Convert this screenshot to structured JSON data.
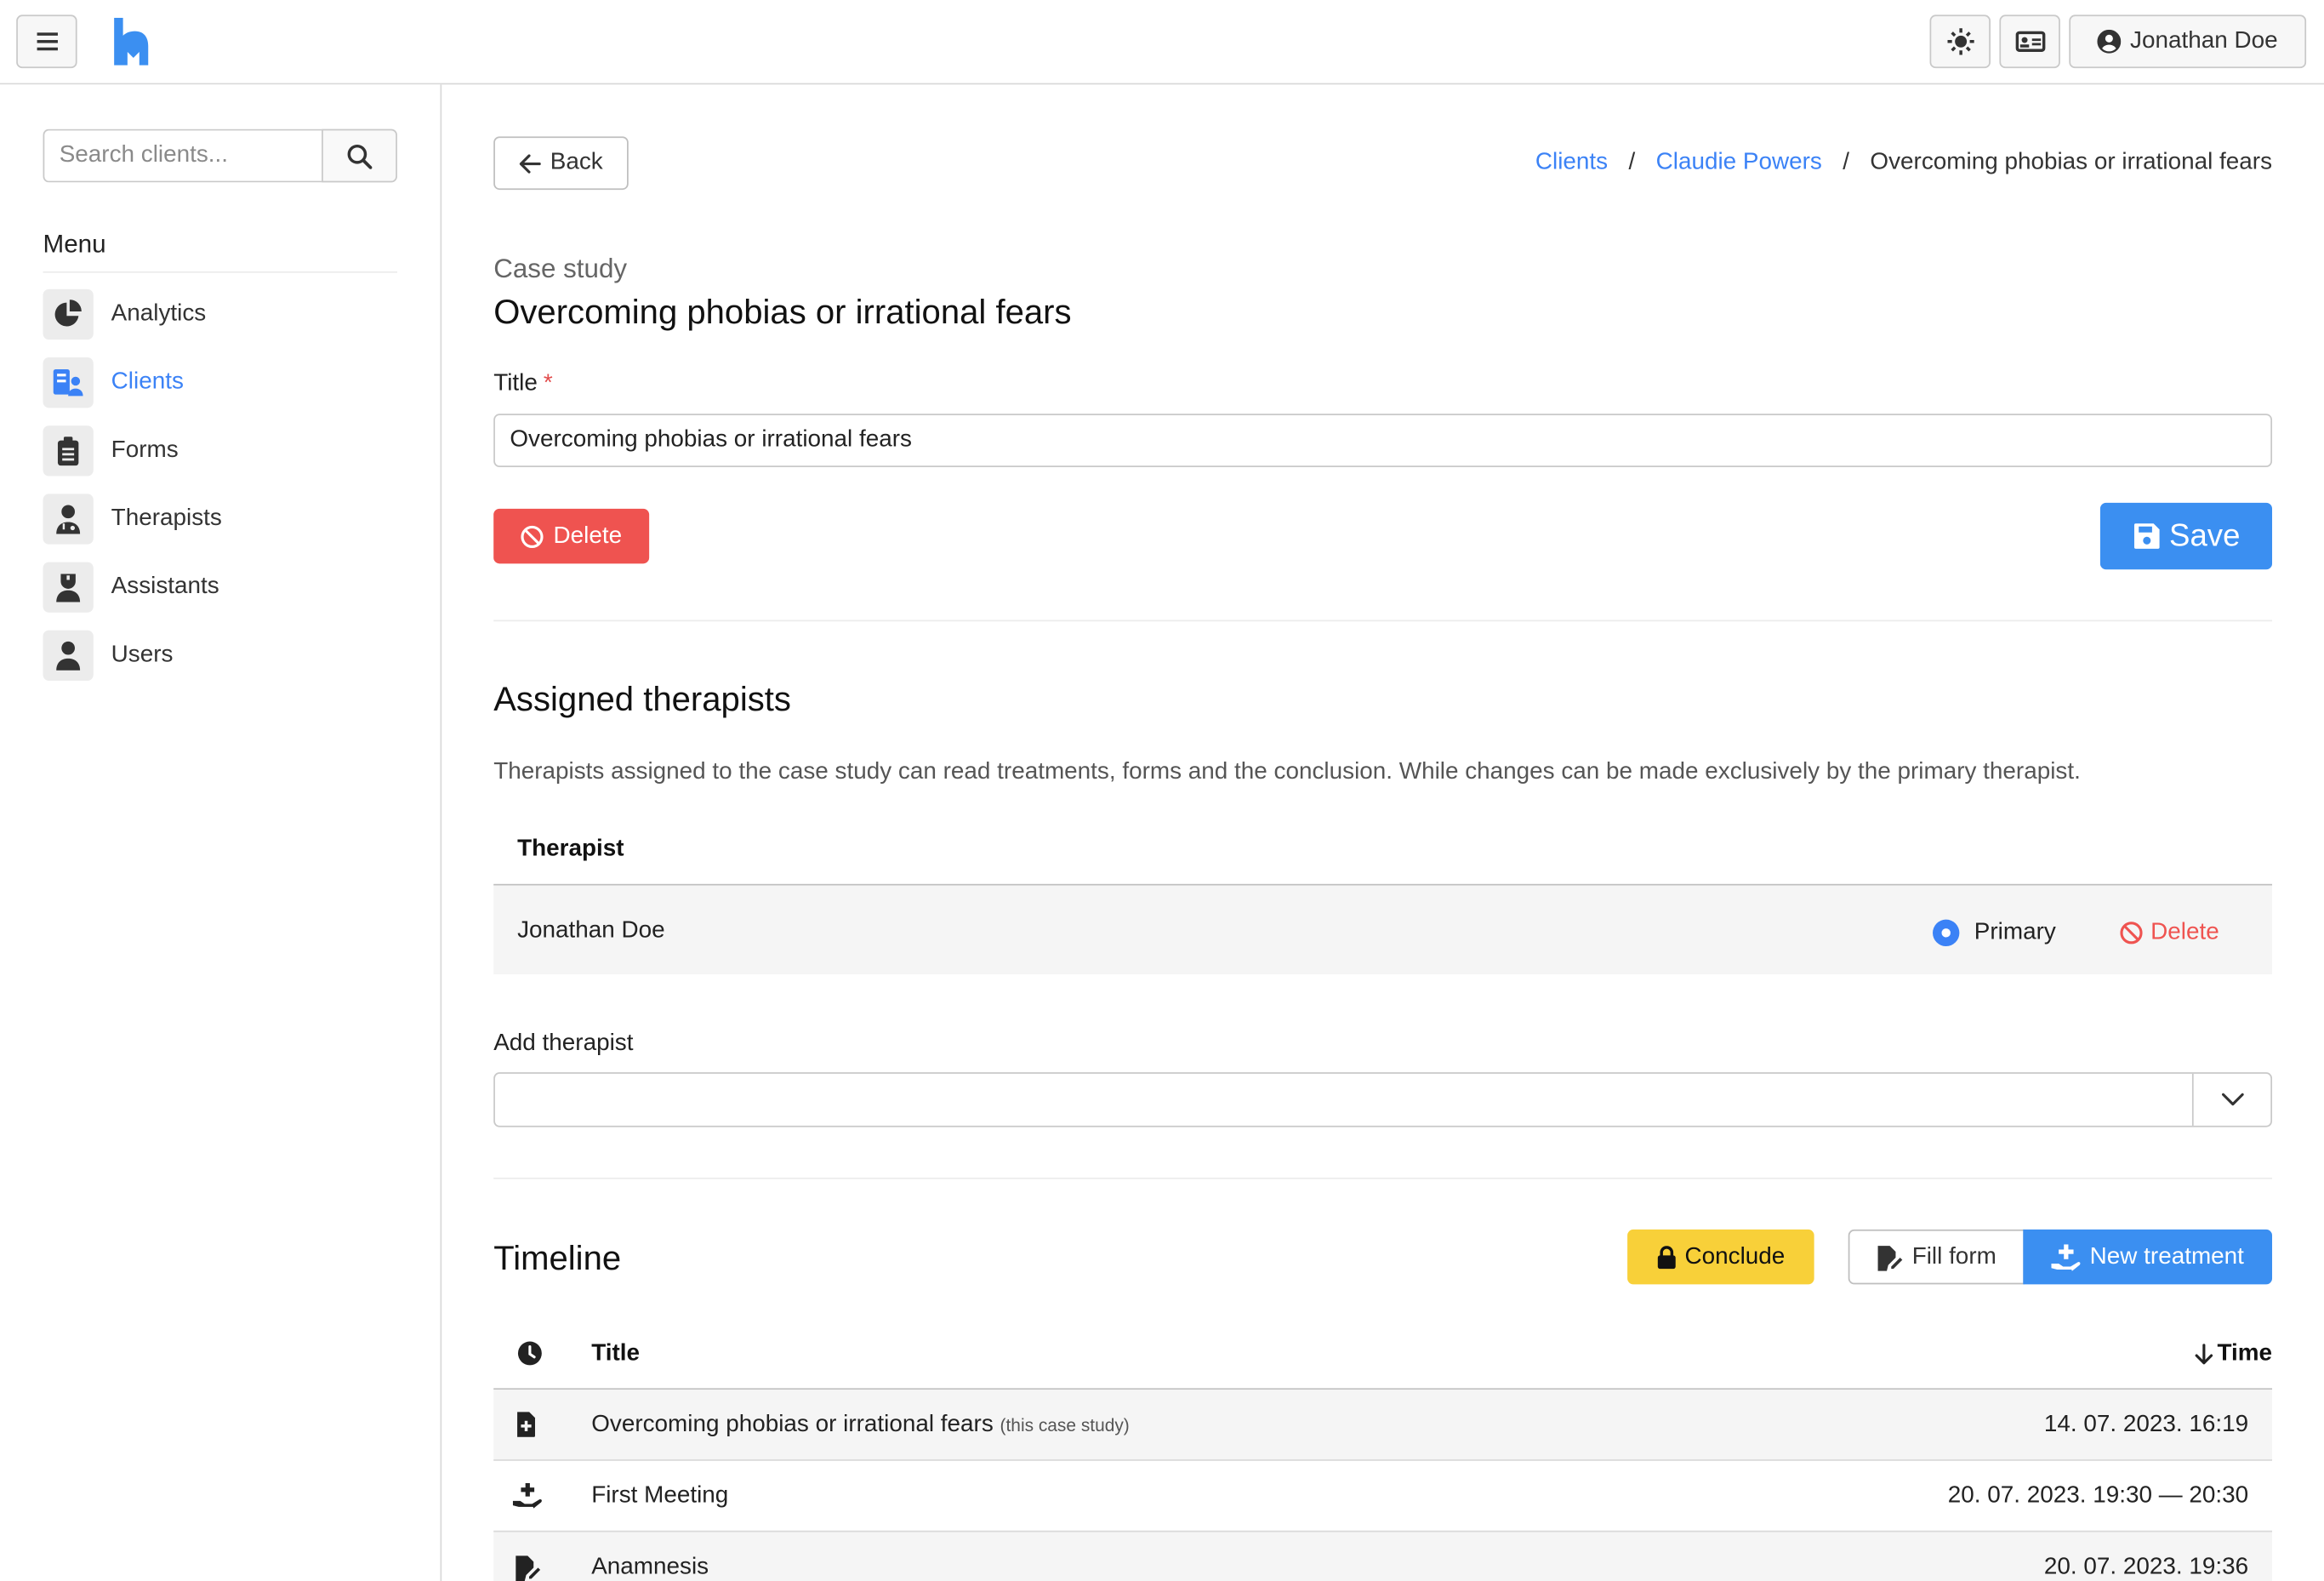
{
  "navbar": {
    "user_name": "Jonathan Doe"
  },
  "sidebar": {
    "search_placeholder": "Search clients...",
    "menu_title": "Menu",
    "items": [
      {
        "label": "Analytics",
        "icon": "pie-chart-icon"
      },
      {
        "label": "Clients",
        "icon": "client-card-icon",
        "active": true
      },
      {
        "label": "Forms",
        "icon": "clipboard-icon"
      },
      {
        "label": "Therapists",
        "icon": "doctor-icon"
      },
      {
        "label": "Assistants",
        "icon": "nurse-icon"
      },
      {
        "label": "Users",
        "icon": "user-icon"
      }
    ]
  },
  "header": {
    "back_label": "Back",
    "breadcrumb": [
      "Clients",
      "Claudie Powers",
      "Overcoming phobias or irrational fears"
    ],
    "kicker": "Case study",
    "title": "Overcoming phobias or irrational fears"
  },
  "form": {
    "title_label": "Title",
    "required_mark": "*",
    "title_value": "Overcoming phobias or irrational fears",
    "delete_label": "Delete",
    "save_label": "Save"
  },
  "therapists": {
    "heading": "Assigned therapists",
    "description": "Therapists assigned to the case study can read treatments, forms and the conclusion. While changes can be made exclusively by the primary therapist.",
    "column": "Therapist",
    "rows": [
      {
        "name": "Jonathan Doe",
        "primary_label": "Primary",
        "primary": true,
        "delete_label": "Delete"
      }
    ],
    "add_label": "Add therapist"
  },
  "timeline": {
    "heading": "Timeline",
    "conclude_label": "Conclude",
    "fill_form_label": "Fill form",
    "new_treatment_label": "New treatment",
    "col_title": "Title",
    "col_time": "Time",
    "rows": [
      {
        "icon": "file-plus-icon",
        "title": "Overcoming phobias or irrational fears",
        "note": "(this case study)",
        "time": "14. 07. 2023. 16:19"
      },
      {
        "icon": "hand-plus-icon",
        "title": "First Meeting",
        "note": "",
        "time": "20. 07. 2023. 19:30 — 20:30"
      },
      {
        "icon": "file-edit-icon",
        "title": "Anamnesis",
        "note": "",
        "time": "20. 07. 2023. 19:36"
      }
    ]
  },
  "colors": {
    "accent": "#3b82f6",
    "danger": "#ef5350",
    "warning": "#f8d039"
  }
}
